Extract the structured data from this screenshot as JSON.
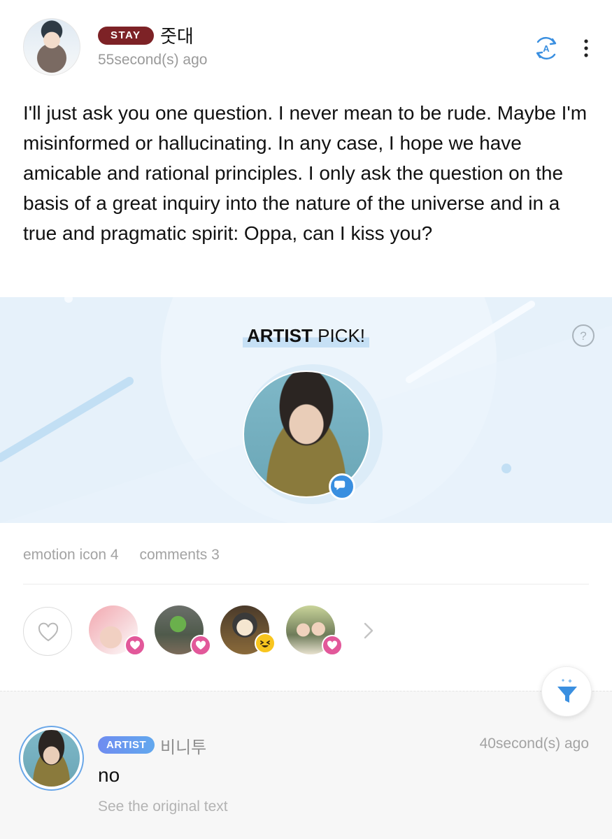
{
  "post": {
    "author_badge": "STAY",
    "author_name": "줏대",
    "timestamp": "55second(s) ago",
    "body": "I'll just ask you one question. I never mean to be rude. Maybe I'm misinformed or hallucinating. In any case, I hope we have amicable and rational principles. I only ask the question on the basis of a great inquiry into the nature of the universe and in a true and pragmatic spirit: Oppa, can I kiss you?"
  },
  "artist_pick": {
    "title_bold": "ARTIST",
    "title_rest": " PICK!"
  },
  "stats": {
    "emotions": "emotion icon 4",
    "comments": "comments 3"
  },
  "reactions": [
    {
      "type": "heart"
    },
    {
      "type": "heart"
    },
    {
      "type": "laugh"
    },
    {
      "type": "heart"
    }
  ],
  "comment": {
    "badge": "ARTIST",
    "author": "비니투",
    "time": "40second(s) ago",
    "text": "no",
    "see_original": "See the original text"
  },
  "colors": {
    "stay_badge": "#7d2226",
    "artist_badge": "#6f8cf0",
    "accent_blue": "#3a8fe0",
    "heart_pink": "#e2589a",
    "banner_bg": "#e6f1fa"
  }
}
